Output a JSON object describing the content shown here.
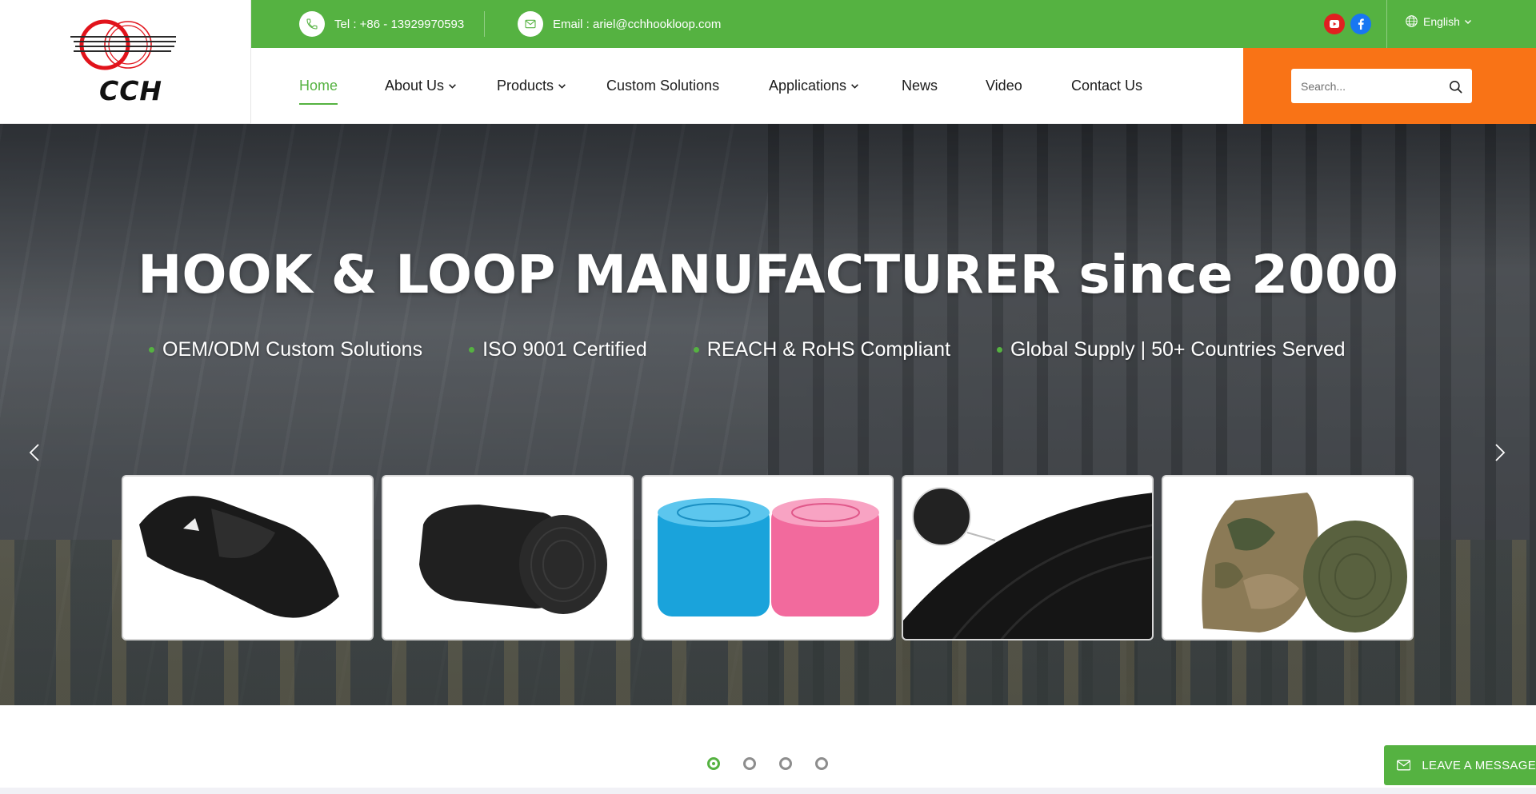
{
  "brand": {
    "logo_text": "CCH",
    "colors": {
      "primary_green": "#55b241",
      "search_orange": "#f97316",
      "youtube_red": "#e02020",
      "facebook_blue": "#1877f2"
    }
  },
  "topbar": {
    "phone": {
      "icon": "phone-icon",
      "text": "Tel : +86 - 13929970593"
    },
    "email": {
      "icon": "mail-icon",
      "text": "Email : ariel@cchhookloop.com"
    },
    "social": [
      "youtube-icon",
      "facebook-icon"
    ],
    "language": "English"
  },
  "nav": {
    "items": [
      {
        "label": "Home",
        "active": true,
        "has_dropdown": false
      },
      {
        "label": "About Us",
        "active": false,
        "has_dropdown": true
      },
      {
        "label": "Products",
        "active": false,
        "has_dropdown": true
      },
      {
        "label": "Custom Solutions",
        "active": false,
        "has_dropdown": false
      },
      {
        "label": "Applications",
        "active": false,
        "has_dropdown": true
      },
      {
        "label": "News",
        "active": false,
        "has_dropdown": false
      },
      {
        "label": "Video",
        "active": false,
        "has_dropdown": false
      },
      {
        "label": "Contact Us",
        "active": false,
        "has_dropdown": false
      }
    ]
  },
  "search": {
    "placeholder": "Search..."
  },
  "hero": {
    "title": "HOOK & LOOP MANUFACTURER since 2000",
    "bullets": [
      "OEM/ODM Custom Solutions",
      "ISO 9001 Certified",
      "REACH & RoHS Compliant",
      "Global Supply | 50+ Countries Served"
    ],
    "product_cards": [
      "black hook-and-loop strap",
      "black hook-and-loop roll",
      "blue and pink loop rolls",
      "black hook tape with detail",
      "camouflage and olive rolls"
    ],
    "slides_total": 4,
    "active_slide": 1
  },
  "leave_message": {
    "label": "LEAVE A MESSAGE",
    "icon": "mail-icon"
  }
}
